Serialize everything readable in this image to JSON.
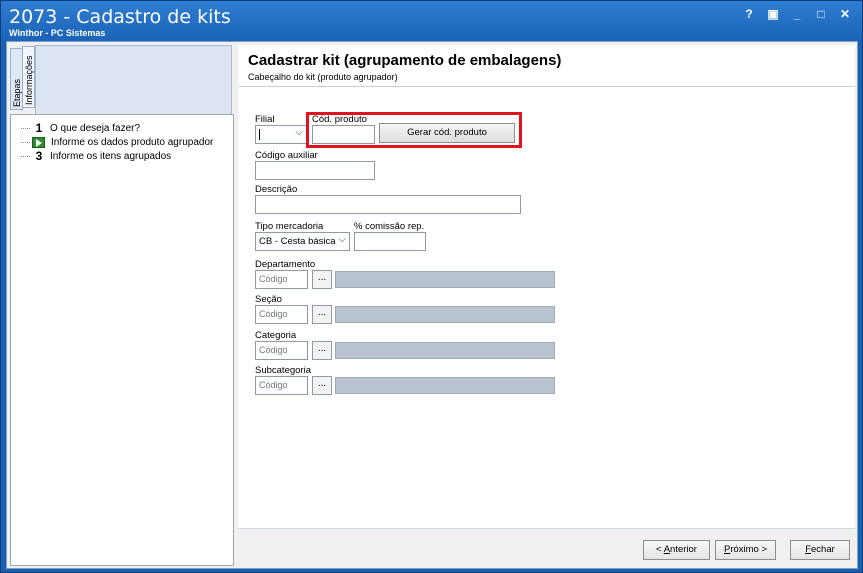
{
  "window": {
    "title": "2073 - Cadastro de kits",
    "subtitle": "Winthor - PC Sistemas",
    "controls": [
      "?",
      "▣",
      "_",
      "□",
      "✕"
    ]
  },
  "left": {
    "tabs": [
      "Etapas",
      "Informações"
    ],
    "steps": [
      {
        "marker": "1",
        "label": "O que deseja fazer?"
      },
      {
        "marker": "arrow",
        "label": "Informe os dados produto agrupador"
      },
      {
        "marker": "3",
        "label": "Informe os itens agrupados"
      }
    ]
  },
  "main": {
    "title": "Cadastrar kit (agrupamento de embalagens)",
    "subtitle": "Cabeçalho do kit (produto agrupador)"
  },
  "form": {
    "filial_label": "Filial",
    "cod_produto_label": "Cód. produto",
    "gerar_button": "Gerar cód. produto",
    "codigo_auxiliar_label": "Código auxiliar",
    "descricao_label": "Descrição",
    "tipo_mercadoria_label": "Tipo mercadoria",
    "tipo_mercadoria_value": "CB - Cesta básica",
    "comissao_label": "% comissão rep.",
    "departamento_label": "Departamento",
    "secao_label": "Seção",
    "categoria_label": "Categoria",
    "subcategoria_label": "Subcategoria",
    "codigo_placeholder": "Código",
    "lookup_button": "..."
  },
  "footer": {
    "anterior_prefix": "< ",
    "anterior_key": "A",
    "anterior_rest": "nterior",
    "proximo_key": "P",
    "proximo_rest": "róximo >",
    "fechar_key": "F",
    "fechar_rest": "echar"
  },
  "colors": {
    "titlebar": "#1a63b8",
    "highlight": "#e0141e",
    "step_arrow": "#2e8b2e"
  }
}
